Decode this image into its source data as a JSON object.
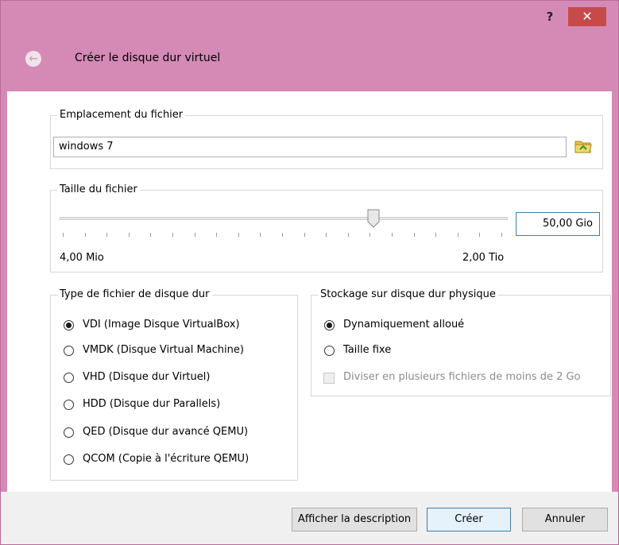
{
  "window": {
    "help_label": "?",
    "close_label": "✕",
    "title": "Créer le disque dur virtuel",
    "accent_close": "#c74a4a",
    "frame_color": "#d58ab6"
  },
  "location": {
    "group_title": "Emplacement du fichier",
    "value": "windows 7"
  },
  "size": {
    "group_title": "Taille du fichier",
    "min_label": "4,00 Mio",
    "max_label": "2,00 Tio",
    "value": "50,00 Gio",
    "slider_fraction": 0.7
  },
  "file_type": {
    "group_title": "Type de fichier de disque dur",
    "options": [
      {
        "label": "VDI (Image Disque VirtualBox)",
        "checked": true
      },
      {
        "label": "VMDK (Disque Virtual Machine)",
        "checked": false
      },
      {
        "label": "VHD (Disque dur Virtuel)",
        "checked": false
      },
      {
        "label": "HDD (Disque dur Parallels)",
        "checked": false
      },
      {
        "label": "QED (Disque dur avancé QEMU)",
        "checked": false
      },
      {
        "label": "QCOM (Copie à l'écriture QEMU)",
        "checked": false
      }
    ]
  },
  "storage": {
    "group_title": "Stockage sur disque dur physique",
    "options": [
      {
        "label": "Dynamiquement alloué",
        "checked": true
      },
      {
        "label": "Taille fixe",
        "checked": false
      }
    ],
    "split_label": "Diviser en plusieurs fichiers de moins de 2 Go"
  },
  "footer": {
    "describe_label": "Afficher la description",
    "create_label": "Créer",
    "cancel_label": "Annuler"
  }
}
